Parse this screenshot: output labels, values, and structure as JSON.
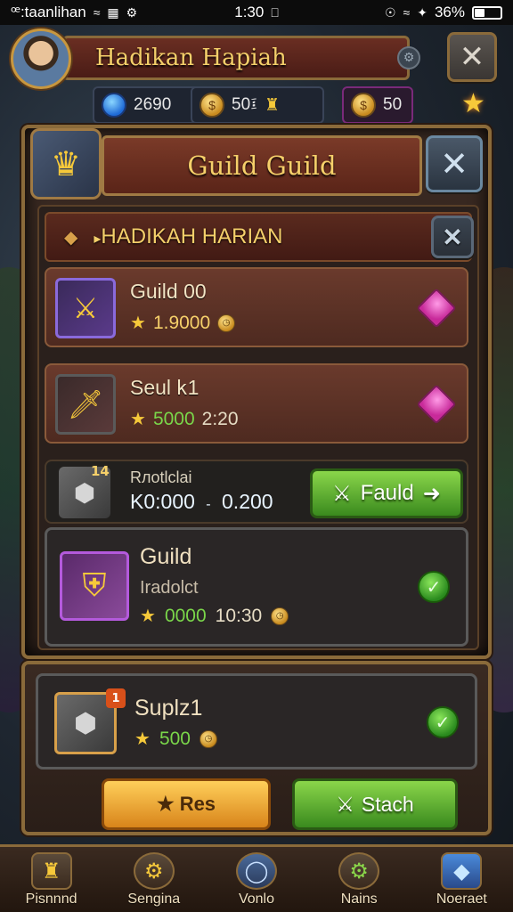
{
  "status_bar": {
    "carrier": "ꟹ:taanlihan",
    "time": "1:30",
    "battery": "36%",
    "battery_level": 0.36
  },
  "header": {
    "title": "Hadikan Hapiah"
  },
  "currencies": [
    {
      "value": "2690",
      "icon": "blue-gem-icon"
    },
    {
      "value": "50፤",
      "icon": "gold-coin-icon"
    },
    {
      "value": "50",
      "icon": "gold-coin-icon"
    }
  ],
  "panel": {
    "title": "Guild Guild",
    "sub_header": "HADIKAH HARIAN"
  },
  "quests": [
    {
      "title": "Guild 00",
      "reward": "1.9000",
      "time": ""
    },
    {
      "title": "Seul 𐌺1",
      "reward": "5000",
      "time": "2:20"
    }
  ],
  "highlight_row": {
    "badge": "14",
    "label": "Rлotlclai",
    "value": "K0:000",
    "sep": "-",
    "value2": "0.200",
    "button_label": "Fauld"
  },
  "big_card": {
    "title": "Guild",
    "subtitle": "Iradolct",
    "reward": "0000",
    "time": "10:30"
  },
  "supply": {
    "badge": "1",
    "title": "Suplz1",
    "reward": "500"
  },
  "buttons": {
    "orange": "Res",
    "green": "Stach"
  },
  "bottom_nav": [
    {
      "label": "Pisnnnd",
      "icon": "castle-icon"
    },
    {
      "label": "Sengina",
      "icon": "shield-icon"
    },
    {
      "label": "Vonlo",
      "icon": "orb-icon"
    },
    {
      "label": "Nains",
      "icon": "gear-icon"
    },
    {
      "label": "Noeraet",
      "icon": "crystal-icon"
    }
  ]
}
